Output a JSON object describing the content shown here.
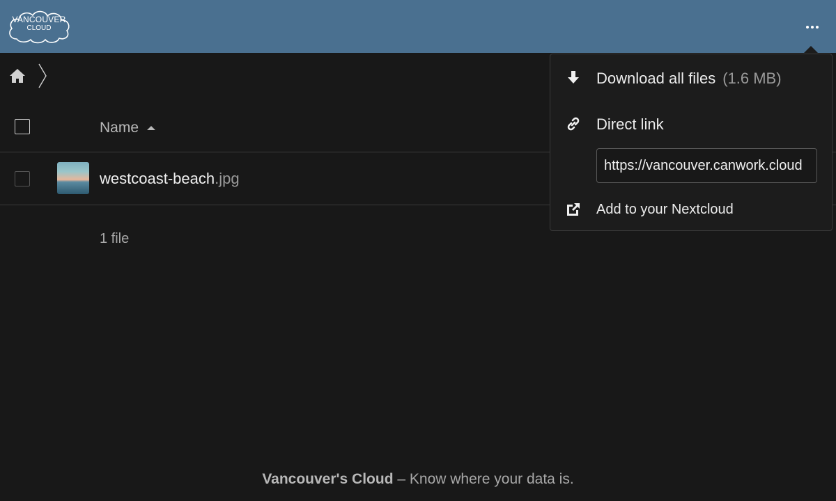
{
  "header": {
    "logo_line1": "VANCOUVER",
    "logo_line2": "CLOUD",
    "background": "#4a7090",
    "more_icon": "three-dots-icon"
  },
  "breadcrumb": {
    "home_icon": "home-icon",
    "separator_icon": "chevron-right-icon"
  },
  "file_list": {
    "name_column": "Name",
    "sort_icon": "sort-ascending-icon",
    "files": [
      {
        "basename": "westcoast-beach",
        "extension": ".jpg"
      }
    ],
    "summary": "1 file"
  },
  "menu": {
    "download_label": "Download all files",
    "download_size": "(1.6 MB)",
    "download_icon": "download-arrow-icon",
    "direct_link_label": "Direct link",
    "direct_link_icon": "link-icon",
    "direct_link_value": "https://vancouver.canwork.cloud",
    "add_label": "Add to your Nextcloud",
    "add_icon": "external-link-icon"
  },
  "footer": {
    "brand": "Vancouver's Cloud",
    "tagline": " – Know where your data is."
  }
}
